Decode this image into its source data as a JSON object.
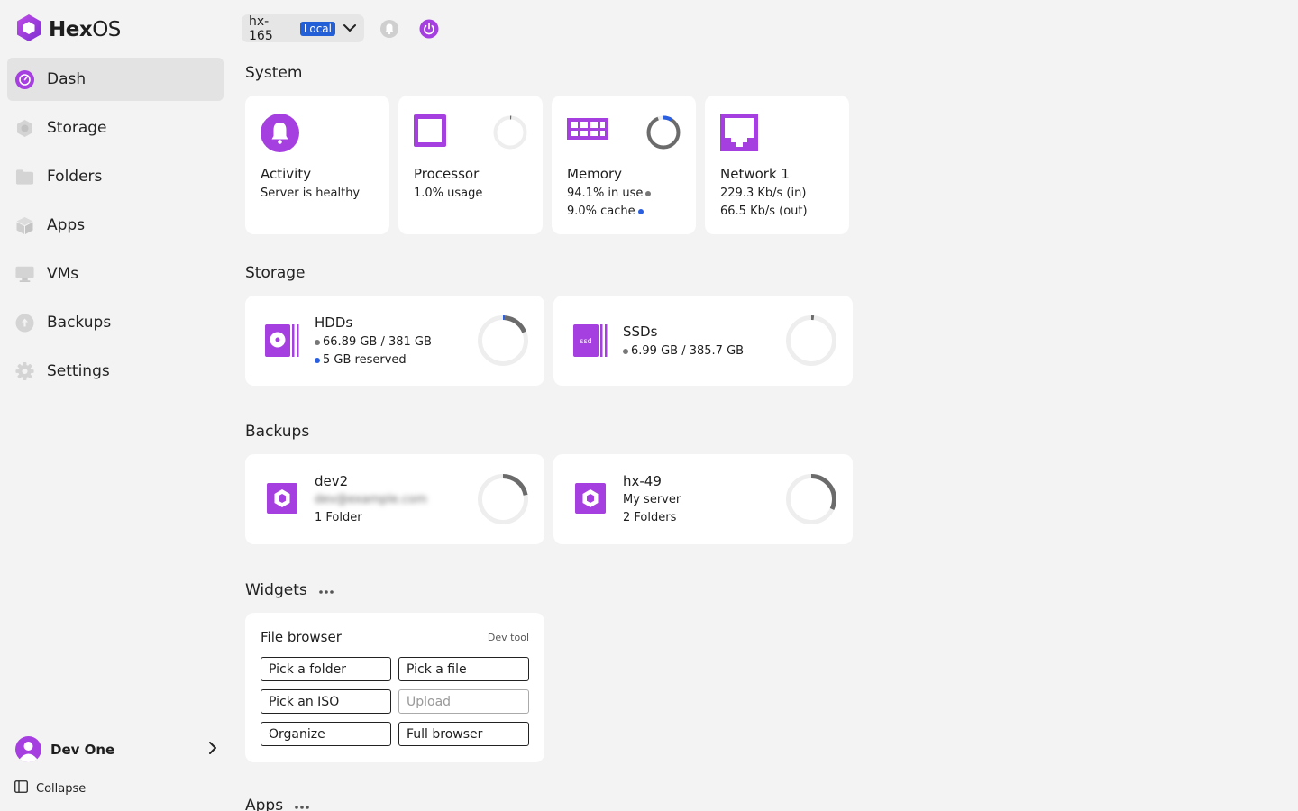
{
  "brand": {
    "name_bold": "Hex",
    "name_light": "OS"
  },
  "nav": [
    {
      "label": "Dash",
      "icon": "dash-icon",
      "active": true
    },
    {
      "label": "Storage",
      "icon": "storage-icon"
    },
    {
      "label": "Folders",
      "icon": "folder-icon"
    },
    {
      "label": "Apps",
      "icon": "apps-icon"
    },
    {
      "label": "VMs",
      "icon": "vm-icon"
    },
    {
      "label": "Backups",
      "icon": "backup-icon"
    },
    {
      "label": "Settings",
      "icon": "settings-icon"
    }
  ],
  "user": {
    "name": "Dev One"
  },
  "collapse_label": "Collapse",
  "server": {
    "name": "hx-165",
    "badge": "Local"
  },
  "sections": {
    "system": "System",
    "storage": "Storage",
    "backups": "Backups",
    "widgets": "Widgets",
    "apps": "Apps"
  },
  "system": {
    "activity": {
      "title": "Activity",
      "line1": "Server is healthy"
    },
    "processor": {
      "title": "Processor",
      "line1": "1.0% usage",
      "usage_fraction": 0.01
    },
    "memory": {
      "title": "Memory",
      "line1": "94.1% in use",
      "line2": "9.0% cache",
      "in_use_fraction": 0.941,
      "cache_fraction": 0.09
    },
    "network": {
      "title": "Network 1",
      "line1": "229.3 Kb/s (in)",
      "line2": "66.5 Kb/s (out)"
    }
  },
  "storage": {
    "hdds": {
      "title": "HDDs",
      "line1": "66.89 GB / 381 GB",
      "line2": "5 GB reserved",
      "used_fraction": 0.176,
      "reserved_fraction": 0.013
    },
    "ssds": {
      "title": "SSDs",
      "line1": "6.99 GB / 385.7 GB",
      "used_fraction": 0.018,
      "icon_label": "ssd"
    }
  },
  "backups": [
    {
      "title": "dev2",
      "line1": "dev@example.com",
      "line2": "1 Folder",
      "fraction": 0.22
    },
    {
      "title": "hx-49",
      "line1": "My server",
      "line2": "2 Folders",
      "fraction": 0.32
    }
  ],
  "widget": {
    "title": "File browser",
    "tag": "Dev tool",
    "buttons": [
      "Pick a folder",
      "Pick a file",
      "Pick an ISO",
      "Upload",
      "Organize",
      "Full browser"
    ]
  },
  "colors": {
    "brand": "#a43ad8",
    "accent_blue": "#2a5fe0",
    "ring_track": "#eeeeee",
    "ring_used": "#6b6b6b"
  }
}
